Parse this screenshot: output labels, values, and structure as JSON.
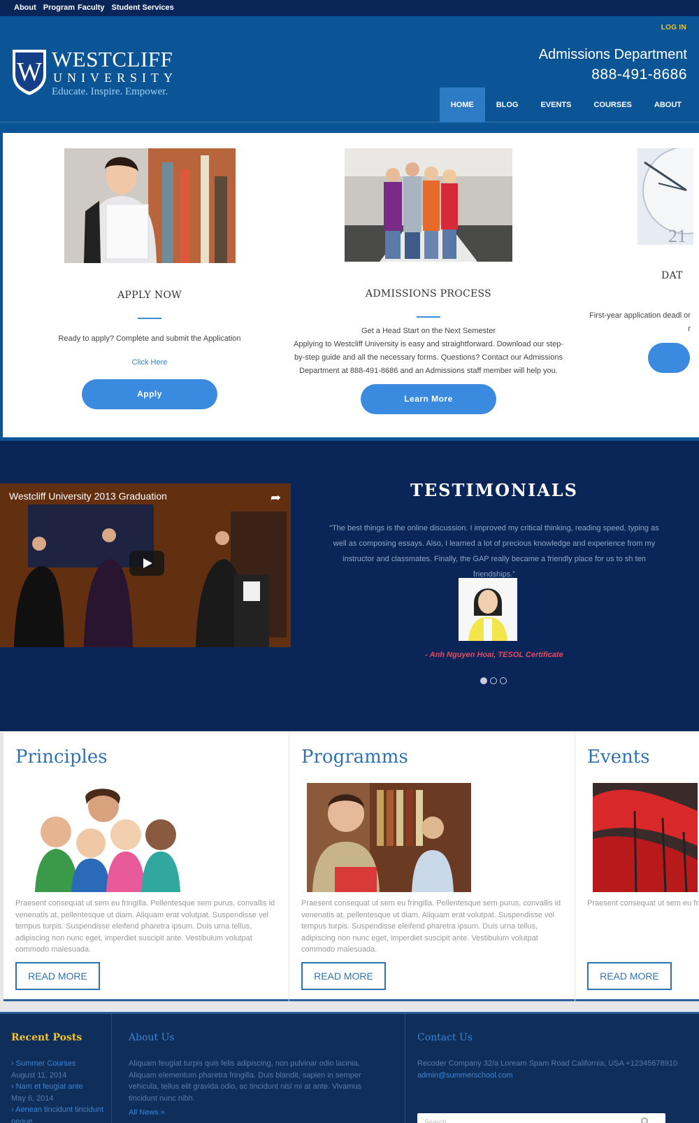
{
  "topbar": {
    "links": [
      "About",
      "Program",
      "Faculty",
      "Student Services"
    ]
  },
  "header": {
    "login": "LOG IN",
    "logo": {
      "name": "WESTCLIFF",
      "sub": "UNIVERSITY",
      "tagline": "Educate. Inspire. Empower."
    },
    "department": "Admissions Department",
    "phone": "888-491-8686",
    "nav": [
      "HOME",
      "BLOG",
      "EVENTS",
      "COURSES",
      "ABOUT"
    ],
    "active_nav": "HOME"
  },
  "features": [
    {
      "title": "APPLY NOW",
      "text": "Ready to apply? Complete and submit the Application",
      "link": "Click Here",
      "button": "Apply"
    },
    {
      "title": "ADMISSIONS PROCESS",
      "text": "Get a Head Start on the Next Semester\nApplying to Westcliff University is easy and straightforward. Download our step-by-step guide and all the necessary forms. Questions? Contact our Admissions Department at 888-491-8686 and an Admissions staff member will help you.",
      "button": "Learn More"
    },
    {
      "title": "DAT",
      "text": "First-year application deadl or r"
    }
  ],
  "video": {
    "title": "Westcliff University 2013 Graduation"
  },
  "testimonials": {
    "heading": "TESTIMONIALS",
    "quote": "“The best things is the online discussion. I improved my critical thinking, reading speed, typing as well as composing essays. Also, I learned a lot of precious knowledge and experience from my instructor and classmates. Finally, the GAP really became a friendly place for us to sh                    ten friendships.”",
    "author": "-  Anh Nguyen Hoai, TESOL Certificate",
    "active_dot": 1
  },
  "cards": [
    {
      "title": "Principles",
      "text": "Praesent consequat ut sem eu fringilla. Pellentesque sem purus, convallis id venenatis at, pellentesque ut diam. Aliquam erat volutpat. Suspendisse vel tempus turpis. Suspendisse eleifend pharetra ipsum. Duis urna tellus, adipiscing non nunc eget, imperdiet suscipit ante. Vestibulum volutpat commodo malesuada.",
      "button": "READ MORE"
    },
    {
      "title": "Programms",
      "text": "Praesent consequat ut sem eu fringilla. Pellentesque sem purus, convallis id venenatis at, pellentesque ut diam. Aliquam erat volutpat. Suspendisse vel tempus turpis. Suspendisse eleifend pharetra ipsum. Duis urna tellus, adipiscing non nunc eget, imperdiet suscipit ante. Vestibulum volutpat commodo malesuada.",
      "button": "READ MORE"
    },
    {
      "title": "Events",
      "text": "Praesent consequat ut sem eu fringilla. Pellentesque sem purus, convallis id venenatis at, pellentesque ut diam. Aliquam erat volutpat. Suspendisse vel tempus turpis. Suspendisse eleifend pharetra ipsum. Duis urna tellus, adipiscing non nunc eget, imperdiet suscipit ante. Vestibulum volutpat commodo malesuada.",
      "button": "READ MORE"
    }
  ],
  "footer": {
    "recent_posts": {
      "heading": "Recent Posts",
      "items": [
        {
          "title": "Summer Courses",
          "date": "August 11, 2014"
        },
        {
          "title": "Nam et feugiat ante",
          "date": "May 6, 2014"
        },
        {
          "title": "Aenean tincidunt tincidunt neque",
          "date": ""
        }
      ]
    },
    "about": {
      "heading": "About Us",
      "text": "Aliquam feugiat turpis quis felis adipiscing, non pulvinar odio lacinia. Aliquam elementum pharetra fringilla. Duis blandit, sapien in semper vehicula, tellus elit gravida odio, ac tincidunt nisl mi at ante. Vivamus tincidunt nunc nibh.",
      "link": "All News »"
    },
    "contact": {
      "heading": "Contact Us",
      "address": "Recoder Company 32/a Loream Spam Road California, USA +12345678910",
      "email": "admin@summerschool.com",
      "search_placeholder": "Search..."
    }
  },
  "colors": {
    "brand_blue": "#0b5596",
    "dark_navy": "#0a2659",
    "accent": "#3a8adf",
    "gold": "#f5c330",
    "quote_author": "#e44b5e"
  }
}
